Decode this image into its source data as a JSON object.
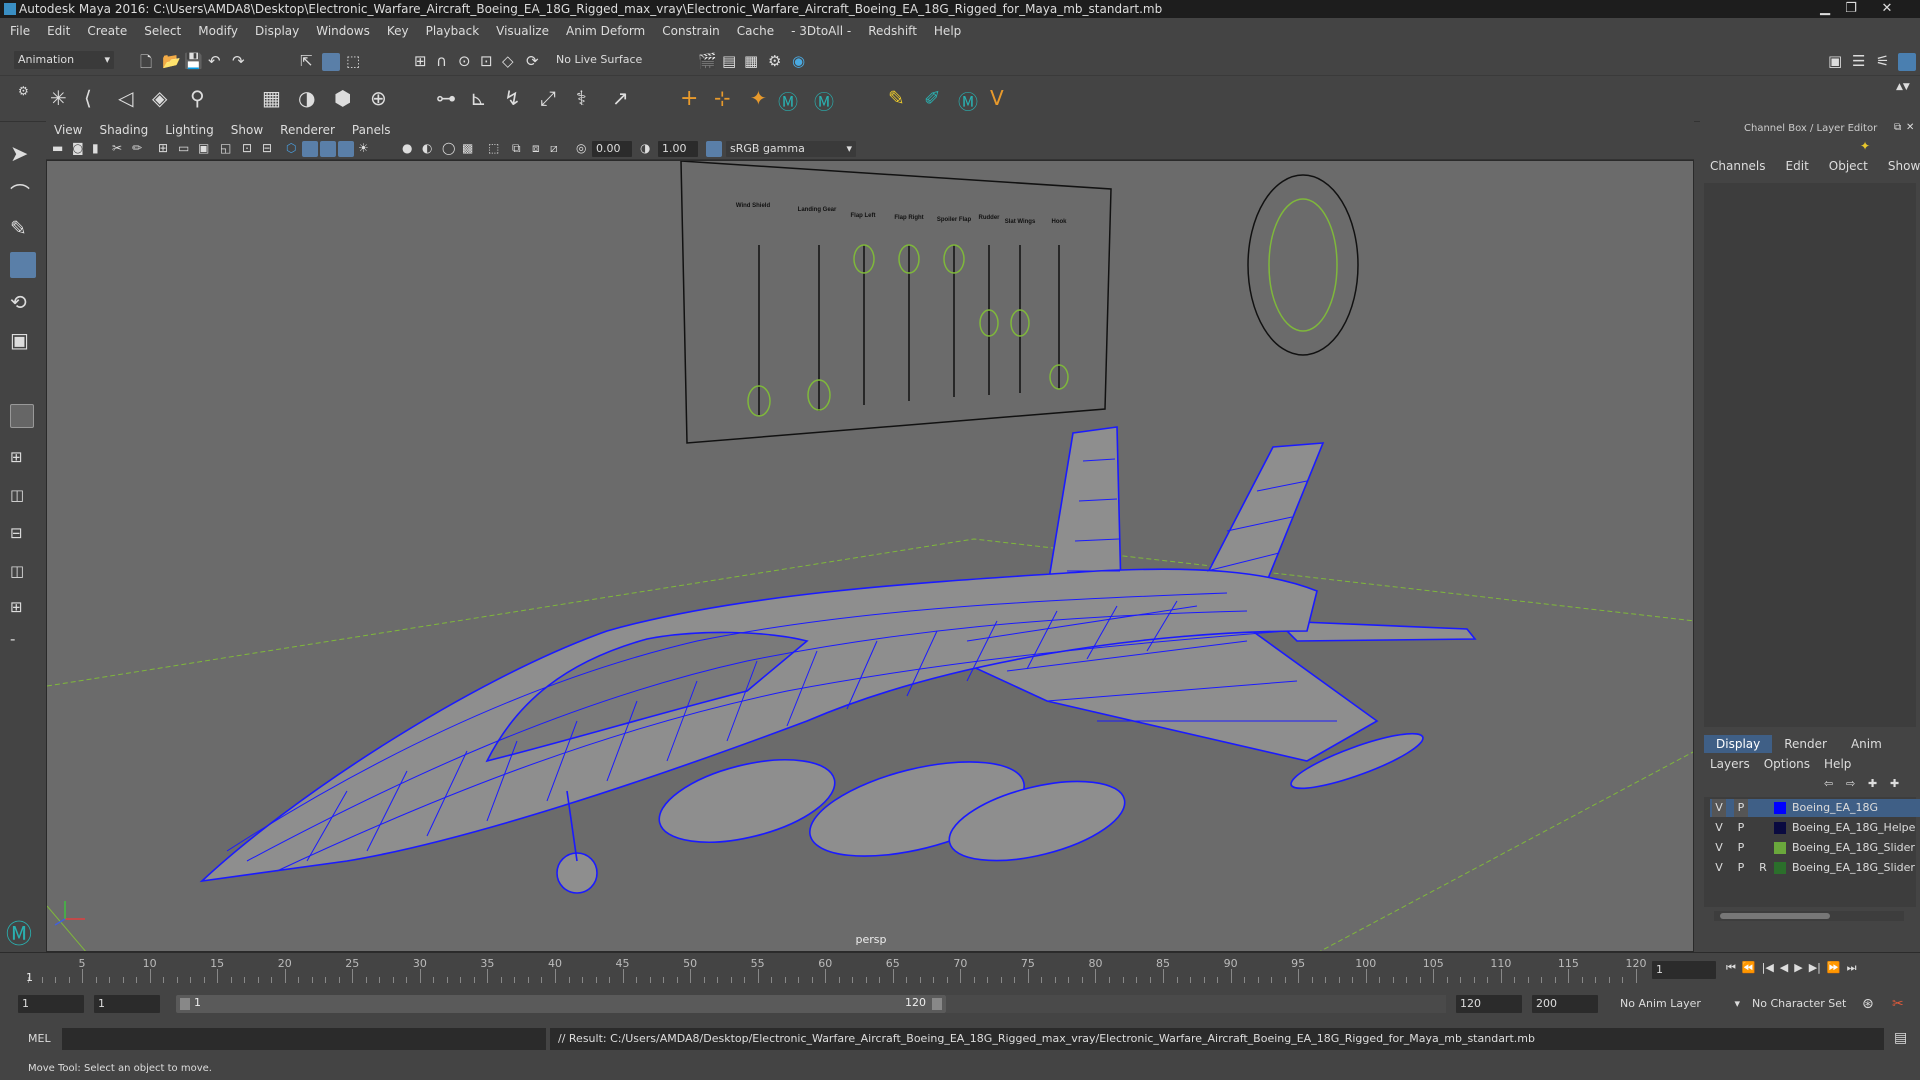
{
  "window": {
    "title": "Autodesk Maya 2016: C:\\Users\\AMDA8\\Desktop\\Electronic_Warfare_Aircraft_Boeing_EA_18G_Rigged_max_vray\\Electronic_Warfare_Aircraft_Boeing_EA_18G_Rigged_for_Maya_mb_standart.mb",
    "minimize": "▁",
    "maximize": "❐",
    "close": "✕"
  },
  "menubar": [
    "File",
    "Edit",
    "Create",
    "Select",
    "Modify",
    "Display",
    "Windows",
    "Key",
    "Playback",
    "Visualize",
    "Anim Deform",
    "Constrain",
    "Cache",
    "- 3DtoAll -",
    "Redshift",
    "Help"
  ],
  "statusline": {
    "mode": "Animation",
    "live_surface": "No Live Surface"
  },
  "panel_menu": [
    "View",
    "Shading",
    "Lighting",
    "Show",
    "Renderer",
    "Panels"
  ],
  "viewbar": {
    "exposure": "0.00",
    "gamma": "1.00",
    "colorspace": "sRGB gamma"
  },
  "viewport": {
    "camera": "persp",
    "slider_labels": [
      "Wind Shield",
      "Landing Gear",
      "Flap Left",
      "Flap Right",
      "Spoiler Flap",
      "Rudder",
      "Slat Wings",
      "Hook"
    ]
  },
  "channelbox": {
    "title": "Channel Box / Layer Editor",
    "menu": [
      "Channels",
      "Edit",
      "Object",
      "Show"
    ]
  },
  "layer_editor": {
    "tabs": [
      "Display",
      "Render",
      "Anim"
    ],
    "menu": [
      "Layers",
      "Options",
      "Help"
    ],
    "layers": [
      {
        "v": "V",
        "p": "P",
        "r": "",
        "name": "Boeing_EA_18G",
        "color": "#0000ff",
        "selected": true
      },
      {
        "v": "V",
        "p": "P",
        "r": "",
        "name": "Boeing_EA_18G_Helpe",
        "color": "#0a0a40",
        "selected": false
      },
      {
        "v": "V",
        "p": "P",
        "r": "",
        "name": "Boeing_EA_18G_Slider",
        "color": "#6aa83c",
        "selected": false
      },
      {
        "v": "V",
        "p": "P",
        "r": "R",
        "name": "Boeing_EA_18G_Slider",
        "color": "#2b6f2b",
        "selected": false
      }
    ]
  },
  "timeline": {
    "ticks": [
      "5",
      "10",
      "15",
      "20",
      "25",
      "30",
      "35",
      "40",
      "45",
      "50",
      "55",
      "60",
      "65",
      "70",
      "75",
      "80",
      "85",
      "90",
      "95",
      "100",
      "105",
      "110",
      "115",
      "120"
    ],
    "first": "1",
    "current_frame": "1",
    "playback_icons": [
      "⏮",
      "⏪",
      "|◀",
      "◀",
      "▶",
      "▶|",
      "⏩",
      "⏭"
    ]
  },
  "range": {
    "start": "1",
    "start2": "1",
    "slider_start": "1",
    "slider_end": "120",
    "end": "120",
    "end2": "200",
    "anim_layer": "No Anim Layer",
    "char_set": "No Character Set"
  },
  "cmdline": {
    "lang": "MEL",
    "result": "// Result: C:/Users/AMDA8/Desktop/Electronic_Warfare_Aircraft_Boeing_EA_18G_Rigged_max_vray/Electronic_Warfare_Aircraft_Boeing_EA_18G_Rigged_for_Maya_mb_standart.mb"
  },
  "helpline": "Move Tool: Select an object to move."
}
